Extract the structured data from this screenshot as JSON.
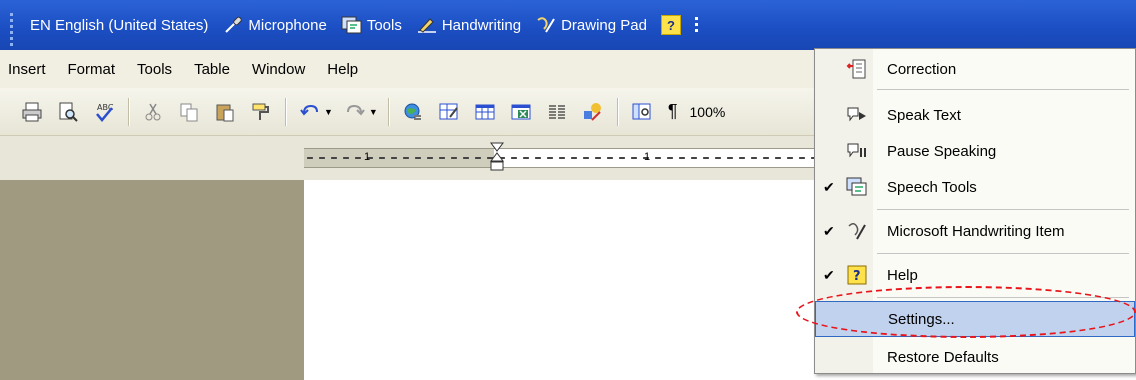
{
  "language_bar": {
    "language": "EN English (United States)",
    "microphone": "Microphone",
    "tools": "Tools",
    "handwriting": "Handwriting",
    "drawing_pad": "Drawing Pad",
    "help_glyph": "?"
  },
  "menubar": {
    "items": [
      "Insert",
      "Format",
      "Tools",
      "Table",
      "Window",
      "Help"
    ]
  },
  "toolbar": {
    "pilcrow": "¶",
    "zoom": "100%"
  },
  "ruler": {
    "labels": [
      "1",
      "1"
    ]
  },
  "dropdown": {
    "items": [
      {
        "label": "Correction",
        "checked": false,
        "icon": "correction-icon"
      },
      {
        "label": "Speak Text",
        "checked": false,
        "icon": "speak-text-icon"
      },
      {
        "label": "Pause Speaking",
        "checked": false,
        "icon": "pause-speaking-icon"
      },
      {
        "label": "Speech Tools",
        "checked": true,
        "icon": "speech-tools-icon"
      },
      {
        "label": "Microsoft Handwriting Item",
        "checked": true,
        "icon": "handwriting-icon"
      },
      {
        "label": "Help",
        "checked": true,
        "icon": "help-icon"
      },
      {
        "label": "Settings...",
        "checked": false,
        "icon": "",
        "selected": true
      },
      {
        "label": "Restore Defaults",
        "checked": false,
        "icon": ""
      }
    ],
    "check_glyph": "✔"
  }
}
